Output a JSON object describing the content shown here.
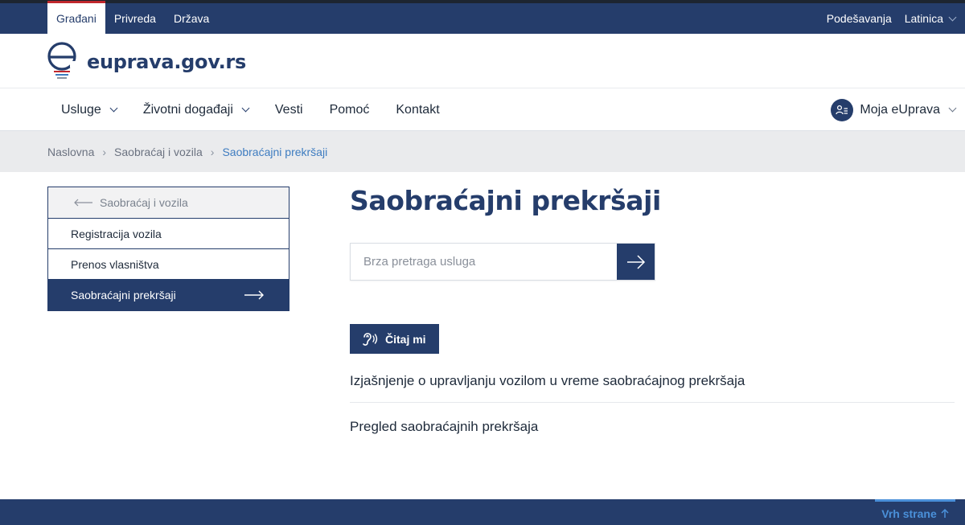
{
  "topbar": {
    "tabs": [
      "Građani",
      "Privreda",
      "Država"
    ],
    "settings_label": "Podešavanja",
    "language_label": "Latinica"
  },
  "logo": {
    "text": "euprava.gov.rs"
  },
  "nav": {
    "items": [
      "Usluge",
      "Životni događaji",
      "Vesti",
      "Pomoć",
      "Kontakt"
    ],
    "account_label": "Moja eUprava"
  },
  "breadcrumb": [
    "Naslovna",
    "Saobraćaj i vozila",
    "Saobraćajni prekršaji"
  ],
  "sidemenu": {
    "back_label": "Saobraćaj i vozila",
    "items": [
      "Registracija vozila",
      "Prenos vlasništva",
      "Saobraćajni prekršaji"
    ]
  },
  "main": {
    "title": "Saobraćajni prekršaji",
    "search_placeholder": "Brza pretraga usluga",
    "read_button": "Čitaj mi",
    "links": [
      "Izjašnjenje o upravljanju vozilom u vreme saobraćajnog prekršaja",
      "Pregled saobraćajnih prekršaja"
    ]
  },
  "footer": {
    "to_top_label": "Vrh strane"
  },
  "colors": {
    "primary": "#253d6b",
    "accent": "#c0272d",
    "link": "#3e7cc0",
    "breadcrumb_bg": "#eaebed"
  }
}
